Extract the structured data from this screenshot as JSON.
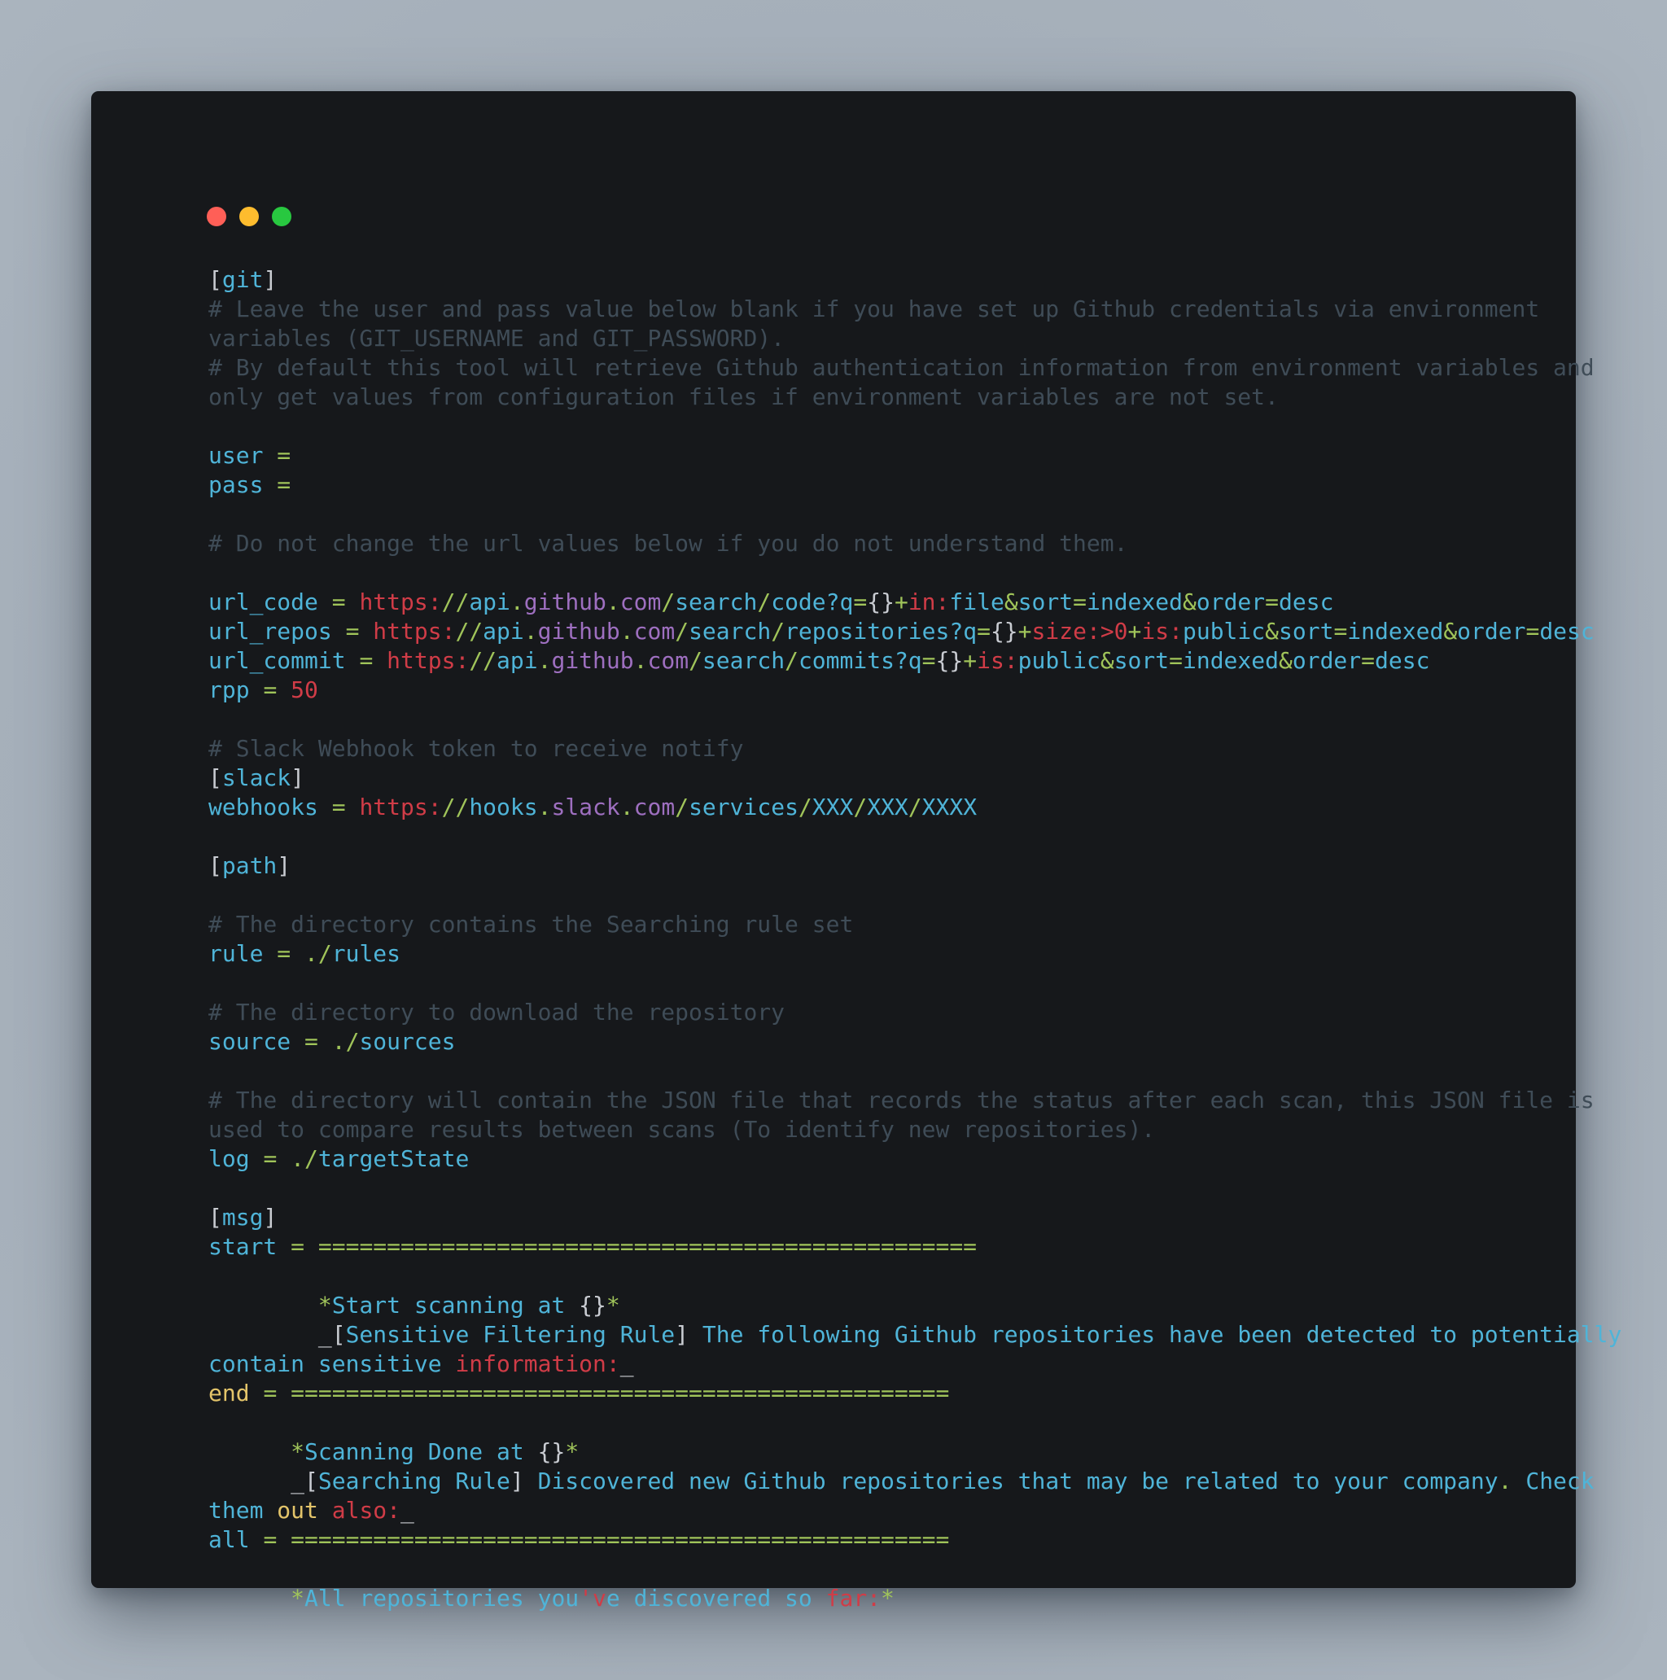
{
  "window": {
    "title_buttons": [
      "close",
      "minimize",
      "maximize"
    ],
    "colors": {
      "background": "#16181b",
      "key": "#4fb4d8",
      "operator": "#a0c45a",
      "string": "#d03c47",
      "host": "#9e6fc0",
      "comment": "#3f4c57",
      "plain": "#c9ccd2",
      "highlight": "#e3c46a"
    }
  },
  "code_lines": [
    [
      [
        "plain",
        "["
      ],
      [
        "key",
        "git"
      ],
      [
        "plain",
        "]"
      ]
    ],
    [
      [
        "com",
        "# Leave the user and pass value below blank if you have set up Github credentials via environment"
      ]
    ],
    [
      [
        "com",
        "variables (GIT_USERNAME and GIT_PASSWORD)."
      ]
    ],
    [
      [
        "com",
        "# By default this tool will retrieve Github authentication information from environment variables and"
      ]
    ],
    [
      [
        "com",
        "only get values from configuration files if environment variables are not set."
      ]
    ],
    [],
    [
      [
        "key",
        "user"
      ],
      [
        "plain",
        " "
      ],
      [
        "op",
        "="
      ]
    ],
    [
      [
        "key",
        "pass"
      ],
      [
        "plain",
        " "
      ],
      [
        "op",
        "="
      ]
    ],
    [],
    [
      [
        "com",
        "# Do not change the url values below if you do not understand them."
      ]
    ],
    [],
    [
      [
        "key",
        "url_code"
      ],
      [
        "plain",
        " "
      ],
      [
        "op",
        "="
      ],
      [
        "plain",
        " "
      ],
      [
        "str",
        "https:"
      ],
      [
        "op",
        "//"
      ],
      [
        "key",
        "api"
      ],
      [
        "op",
        "."
      ],
      [
        "host",
        "github"
      ],
      [
        "op",
        "."
      ],
      [
        "host",
        "com"
      ],
      [
        "op",
        "/"
      ],
      [
        "key",
        "search"
      ],
      [
        "op",
        "/"
      ],
      [
        "key",
        "code?q"
      ],
      [
        "op",
        "="
      ],
      [
        "plain",
        "{}"
      ],
      [
        "op",
        "+"
      ],
      [
        "str",
        "in:"
      ],
      [
        "key",
        "file"
      ],
      [
        "op",
        "&"
      ],
      [
        "key",
        "sort"
      ],
      [
        "op",
        "="
      ],
      [
        "key",
        "indexed"
      ],
      [
        "op",
        "&"
      ],
      [
        "key",
        "order"
      ],
      [
        "op",
        "="
      ],
      [
        "key",
        "desc"
      ]
    ],
    [
      [
        "key",
        "url_repos"
      ],
      [
        "plain",
        " "
      ],
      [
        "op",
        "="
      ],
      [
        "plain",
        " "
      ],
      [
        "str",
        "https:"
      ],
      [
        "op",
        "//"
      ],
      [
        "key",
        "api"
      ],
      [
        "op",
        "."
      ],
      [
        "host",
        "github"
      ],
      [
        "op",
        "."
      ],
      [
        "host",
        "com"
      ],
      [
        "op",
        "/"
      ],
      [
        "key",
        "search"
      ],
      [
        "op",
        "/"
      ],
      [
        "key",
        "repositories?q"
      ],
      [
        "op",
        "="
      ],
      [
        "plain",
        "{}"
      ],
      [
        "op",
        "+"
      ],
      [
        "str",
        "size:>0"
      ],
      [
        "op",
        "+"
      ],
      [
        "str",
        "is:"
      ],
      [
        "key",
        "public"
      ],
      [
        "op",
        "&"
      ],
      [
        "key",
        "sort"
      ],
      [
        "op",
        "="
      ],
      [
        "key",
        "indexed"
      ],
      [
        "op",
        "&"
      ],
      [
        "key",
        "order"
      ],
      [
        "op",
        "="
      ],
      [
        "key",
        "desc"
      ]
    ],
    [
      [
        "key",
        "url_commit"
      ],
      [
        "plain",
        " "
      ],
      [
        "op",
        "="
      ],
      [
        "plain",
        " "
      ],
      [
        "str",
        "https:"
      ],
      [
        "op",
        "//"
      ],
      [
        "key",
        "api"
      ],
      [
        "op",
        "."
      ],
      [
        "host",
        "github"
      ],
      [
        "op",
        "."
      ],
      [
        "host",
        "com"
      ],
      [
        "op",
        "/"
      ],
      [
        "key",
        "search"
      ],
      [
        "op",
        "/"
      ],
      [
        "key",
        "commits?q"
      ],
      [
        "op",
        "="
      ],
      [
        "plain",
        "{}"
      ],
      [
        "op",
        "+"
      ],
      [
        "str",
        "is:"
      ],
      [
        "key",
        "public"
      ],
      [
        "op",
        "&"
      ],
      [
        "key",
        "sort"
      ],
      [
        "op",
        "="
      ],
      [
        "key",
        "indexed"
      ],
      [
        "op",
        "&"
      ],
      [
        "key",
        "order"
      ],
      [
        "op",
        "="
      ],
      [
        "key",
        "desc"
      ]
    ],
    [
      [
        "key",
        "rpp"
      ],
      [
        "plain",
        " "
      ],
      [
        "op",
        "="
      ],
      [
        "plain",
        " "
      ],
      [
        "str",
        "50"
      ]
    ],
    [],
    [
      [
        "com",
        "# Slack Webhook token to receive notify"
      ]
    ],
    [
      [
        "plain",
        "["
      ],
      [
        "key",
        "slack"
      ],
      [
        "plain",
        "]"
      ]
    ],
    [
      [
        "key",
        "webhooks"
      ],
      [
        "plain",
        " "
      ],
      [
        "op",
        "="
      ],
      [
        "plain",
        " "
      ],
      [
        "str",
        "https:"
      ],
      [
        "op",
        "//"
      ],
      [
        "key",
        "hooks"
      ],
      [
        "op",
        "."
      ],
      [
        "host",
        "slack"
      ],
      [
        "op",
        "."
      ],
      [
        "host",
        "com"
      ],
      [
        "op",
        "/"
      ],
      [
        "key",
        "services"
      ],
      [
        "op",
        "/"
      ],
      [
        "key",
        "XXX"
      ],
      [
        "op",
        "/"
      ],
      [
        "key",
        "XXX"
      ],
      [
        "op",
        "/"
      ],
      [
        "key",
        "XXXX"
      ]
    ],
    [],
    [
      [
        "plain",
        "["
      ],
      [
        "key",
        "path"
      ],
      [
        "plain",
        "]"
      ]
    ],
    [],
    [
      [
        "com",
        "# The directory contains the Searching rule set"
      ]
    ],
    [
      [
        "key",
        "rule"
      ],
      [
        "plain",
        " "
      ],
      [
        "op",
        "="
      ],
      [
        "plain",
        " "
      ],
      [
        "op",
        "./"
      ],
      [
        "key",
        "rules"
      ]
    ],
    [],
    [
      [
        "com",
        "# The directory to download the repository"
      ]
    ],
    [
      [
        "key",
        "source"
      ],
      [
        "plain",
        " "
      ],
      [
        "op",
        "="
      ],
      [
        "plain",
        " "
      ],
      [
        "op",
        "./"
      ],
      [
        "key",
        "sources"
      ]
    ],
    [],
    [
      [
        "com",
        "# The directory will contain the JSON file that records the status after each scan, this JSON file is"
      ]
    ],
    [
      [
        "com",
        "used to compare results between scans (To identify new repositories)."
      ]
    ],
    [
      [
        "key",
        "log"
      ],
      [
        "plain",
        " "
      ],
      [
        "op",
        "="
      ],
      [
        "plain",
        " "
      ],
      [
        "op",
        "./"
      ],
      [
        "key",
        "targetState"
      ]
    ],
    [],
    [
      [
        "plain",
        "["
      ],
      [
        "key",
        "msg"
      ],
      [
        "plain",
        "]"
      ]
    ],
    [
      [
        "key",
        "start"
      ],
      [
        "plain",
        " "
      ],
      [
        "op",
        "="
      ],
      [
        "plain",
        " "
      ],
      [
        "op",
        "================================================"
      ]
    ],
    [],
    [
      [
        "plain",
        "        "
      ],
      [
        "op",
        "*"
      ],
      [
        "key",
        "Start scanning at "
      ],
      [
        "plain",
        "{}"
      ],
      [
        "op",
        "*"
      ]
    ],
    [
      [
        "plain",
        "        _["
      ],
      [
        "key",
        "Sensitive Filtering Rule"
      ],
      [
        "plain",
        "]"
      ],
      [
        "key",
        " The following Github repositories have been detected to potentially"
      ]
    ],
    [
      [
        "key",
        "contain sensitive "
      ],
      [
        "str",
        "information:"
      ],
      [
        "plain",
        "_"
      ]
    ],
    [
      [
        "yel",
        "end"
      ],
      [
        "plain",
        " "
      ],
      [
        "op",
        "="
      ],
      [
        "plain",
        " "
      ],
      [
        "op",
        "================================================"
      ]
    ],
    [],
    [
      [
        "plain",
        "      "
      ],
      [
        "op",
        "*"
      ],
      [
        "key",
        "Scanning Done at "
      ],
      [
        "plain",
        "{}"
      ],
      [
        "op",
        "*"
      ]
    ],
    [
      [
        "plain",
        "      _["
      ],
      [
        "key",
        "Searching Rule"
      ],
      [
        "plain",
        "]"
      ],
      [
        "key",
        " Discovered new Github repositories that may be related to your company"
      ],
      [
        "op",
        "."
      ],
      [
        "key",
        " Check"
      ]
    ],
    [
      [
        "key",
        "them "
      ],
      [
        "yel",
        "out"
      ],
      [
        "plain",
        " "
      ],
      [
        "str",
        "also:"
      ],
      [
        "plain",
        "_"
      ]
    ],
    [
      [
        "key",
        "all"
      ],
      [
        "plain",
        " "
      ],
      [
        "op",
        "="
      ],
      [
        "plain",
        " "
      ],
      [
        "op",
        "================================================"
      ]
    ],
    [],
    [
      [
        "plain",
        "      "
      ],
      [
        "op",
        "*"
      ],
      [
        "key",
        "All repositories you"
      ],
      [
        "str",
        "'v"
      ],
      [
        "key",
        "e discovered so "
      ],
      [
        "str",
        "far:"
      ],
      [
        "op",
        "*"
      ]
    ]
  ]
}
